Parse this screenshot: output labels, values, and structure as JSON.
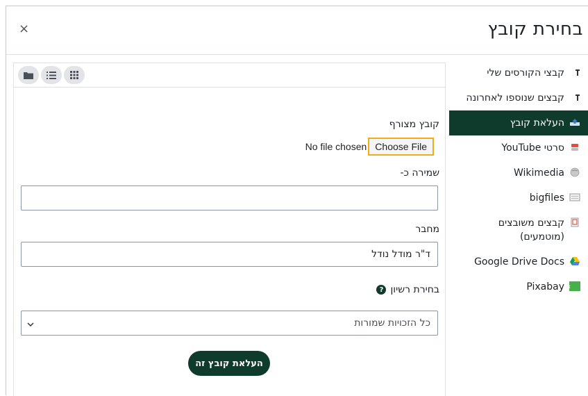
{
  "dialog": {
    "title": "בחירת קובץ",
    "close_glyph": "×"
  },
  "sidebar": {
    "items": [
      {
        "label": "קבצי הקורסים שלי",
        "icon": "repository-icon",
        "active": false
      },
      {
        "label": "קבצים שנוספו לאחרונה",
        "icon": "recent-files-icon",
        "active": false
      },
      {
        "label": "העלאת קובץ",
        "icon": "upload-icon",
        "active": true
      },
      {
        "label": "סרטי YouTube",
        "icon": "youtube-icon",
        "active": false
      },
      {
        "label": "Wikimedia",
        "icon": "wikimedia-icon",
        "active": false
      },
      {
        "label": "bigfiles",
        "icon": "bigfiles-icon",
        "active": false
      },
      {
        "label": "קבצים משובצים (מוטמעים)",
        "icon": "embedded-files-icon",
        "active": false
      },
      {
        "label": "Google Drive Docs",
        "icon": "google-drive-icon",
        "active": false
      },
      {
        "label": "Pixabay",
        "icon": "pixabay-icon",
        "active": false
      }
    ]
  },
  "viewbar": {
    "buttons": [
      "icons-view-icon",
      "list-view-icon",
      "folder-view-icon"
    ]
  },
  "form": {
    "attachment_label": "קובץ מצורף",
    "choose_file_label": "Choose File",
    "no_file_text": "No file chosen",
    "save_as_label": "שמירה כ-",
    "save_as_value": "",
    "author_label": "מחבר",
    "author_value": "ד\"ר מודל נודל",
    "license_label": "בחירת רשיון",
    "license_selected": "כל הזכויות שמורות",
    "upload_button_label": "העלאת קובץ זה"
  },
  "colors": {
    "primary": "#0f3b2c",
    "focus_outline": "#f0ad1a"
  }
}
